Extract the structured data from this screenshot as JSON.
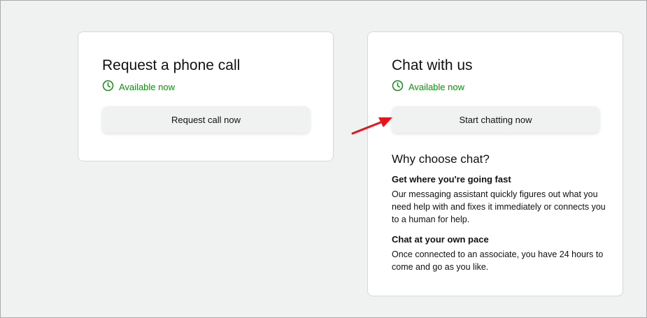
{
  "phone_card": {
    "title": "Request a phone call",
    "availability": "Available now",
    "button_label": "Request call now"
  },
  "chat_card": {
    "title": "Chat with us",
    "availability": "Available now",
    "button_label": "Start chatting now",
    "why_title": "Why choose chat?",
    "reasons": [
      {
        "title": "Get where you're going fast",
        "description": "Our messaging assistant quickly figures out what you need help with and fixes it immediately or connects you to a human for help."
      },
      {
        "title": "Chat at your own pace",
        "description": "Once connected to an associate, you have 24 hours to come and go as you like."
      }
    ]
  },
  "icons": {
    "availability": "clock-icon",
    "annotation": "red-arrow-icon"
  },
  "colors": {
    "available_green": "#108f10",
    "annotation_red": "#e8141b"
  }
}
